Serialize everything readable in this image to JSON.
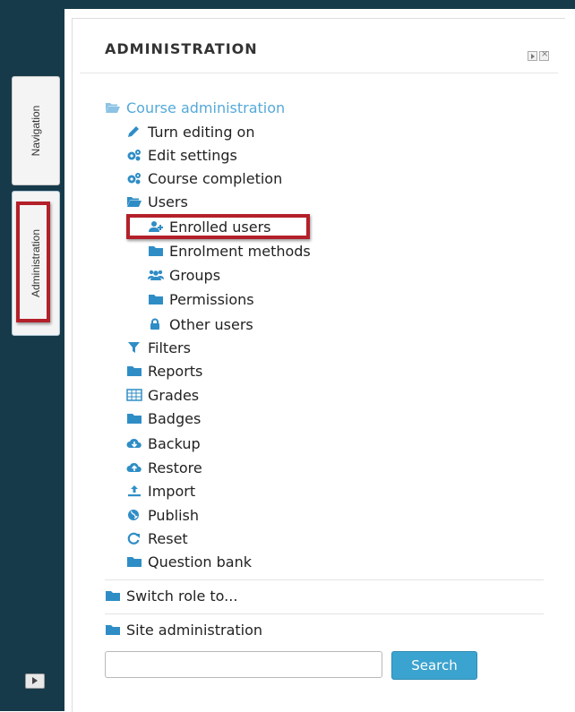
{
  "dock": {
    "tabs": [
      {
        "label": "Navigation"
      },
      {
        "label": "Administration"
      }
    ]
  },
  "block": {
    "title": "ADMINISTRATION",
    "course_admin": {
      "label": "Course administration",
      "items": [
        {
          "label": "Turn editing on",
          "icon": "pencil-icon"
        },
        {
          "label": "Edit settings",
          "icon": "gears-icon"
        },
        {
          "label": "Course completion",
          "icon": "gears-icon"
        },
        {
          "label": "Users",
          "icon": "folder-open-icon"
        },
        {
          "label": "Enrolled users",
          "icon": "add-user-icon"
        },
        {
          "label": "Enrolment methods",
          "icon": "folder-icon"
        },
        {
          "label": "Groups",
          "icon": "group-icon"
        },
        {
          "label": "Permissions",
          "icon": "folder-icon"
        },
        {
          "label": "Other users",
          "icon": "lock-icon"
        },
        {
          "label": "Filters",
          "icon": "filter-icon"
        },
        {
          "label": "Reports",
          "icon": "folder-icon"
        },
        {
          "label": "Grades",
          "icon": "table-icon"
        },
        {
          "label": "Badges",
          "icon": "folder-icon"
        },
        {
          "label": "Backup",
          "icon": "cloud-download-icon"
        },
        {
          "label": "Restore",
          "icon": "cloud-upload-icon"
        },
        {
          "label": "Import",
          "icon": "upload-icon"
        },
        {
          "label": "Publish",
          "icon": "globe-icon"
        },
        {
          "label": "Reset",
          "icon": "refresh-icon"
        },
        {
          "label": "Question bank",
          "icon": "folder-icon"
        }
      ]
    },
    "switch_role": {
      "label": "Switch role to..."
    },
    "site_admin": {
      "label": "Site administration"
    },
    "search": {
      "placeholder": "",
      "button_label": "Search"
    }
  },
  "colors": {
    "dock_bg": "#173a4a",
    "link": "#55a9d9",
    "icon_blue": "#2f8dc6",
    "highlight_red": "#b3202a",
    "search_button": "#3ba3cf"
  }
}
